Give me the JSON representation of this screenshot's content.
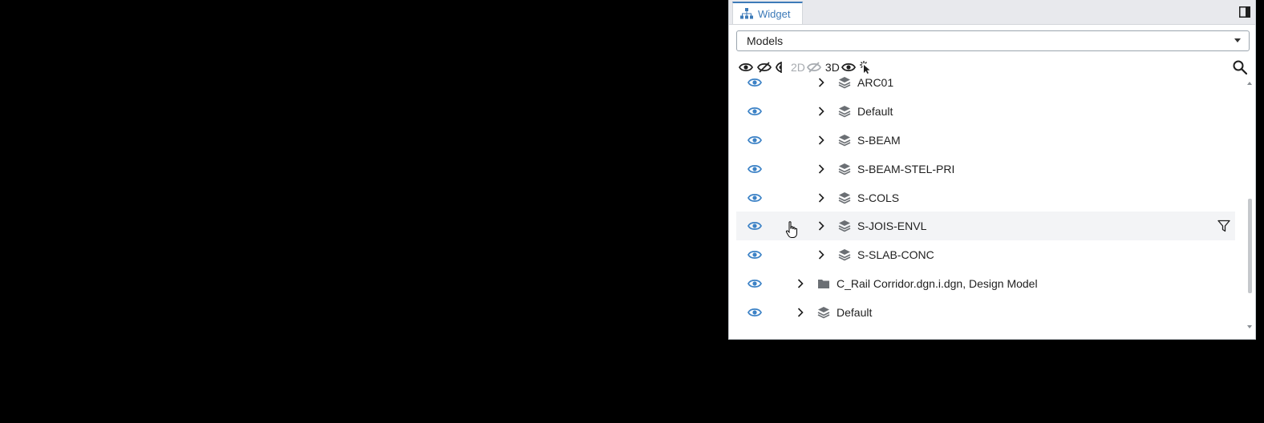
{
  "widget": {
    "tab_label": "Widget",
    "select_value": "Models"
  },
  "toolbar": {
    "label_2d": "2D",
    "label_3d": "3D"
  },
  "tree": {
    "rows": [
      {
        "label": "ARC01",
        "icon": "layers-icon",
        "level": 2
      },
      {
        "label": "Default",
        "icon": "layers-icon",
        "level": 2
      },
      {
        "label": "S-BEAM",
        "icon": "layers-icon",
        "level": 2
      },
      {
        "label": "S-BEAM-STEL-PRI",
        "icon": "layers-icon",
        "level": 2
      },
      {
        "label": "S-COLS",
        "icon": "layers-icon",
        "level": 2
      },
      {
        "label": "S-JOIS-ENVL",
        "icon": "layers-icon",
        "level": 2,
        "hovered": true
      },
      {
        "label": "S-SLAB-CONC",
        "icon": "layers-icon",
        "level": 2
      },
      {
        "label": "C_Rail Corridor.dgn.i.dgn, Design Model",
        "icon": "folder-icon",
        "level": 1
      },
      {
        "label": "Default",
        "icon": "layers-icon",
        "level": 1
      }
    ]
  },
  "colors": {
    "accent": "#3c7ab8",
    "eye_visible": "#3c82c6",
    "text": "#1f1f1f",
    "background": "#000000"
  }
}
